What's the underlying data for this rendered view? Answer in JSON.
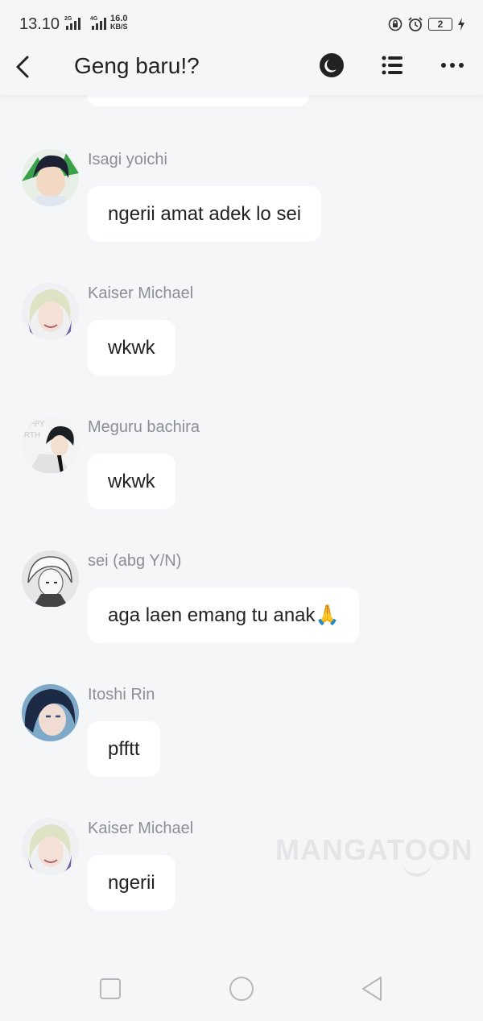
{
  "status_bar": {
    "time": "13.10",
    "net1": "2G",
    "net2": "4G",
    "speed_value": "16.0",
    "speed_unit": "KB/S",
    "battery": "2"
  },
  "header": {
    "title": "Geng baru!?"
  },
  "messages": [
    {
      "sender": "Isagi yoichi",
      "text": "ngerii amat adek lo sei"
    },
    {
      "sender": "Kaiser Michael",
      "text": "wkwk"
    },
    {
      "sender": "Meguru bachira",
      "text": "wkwk"
    },
    {
      "sender": "sei (abg Y/N)",
      "text": "aga laen emang tu anak🙏"
    },
    {
      "sender": "Itoshi Rin",
      "text": "pfftt"
    },
    {
      "sender": "Kaiser Michael",
      "text": "ngerii"
    }
  ],
  "watermark": "MANGATOON",
  "colors": {
    "background": "#f5f6f8",
    "bubble": "#ffffff",
    "sender_text": "#8a8f96"
  }
}
